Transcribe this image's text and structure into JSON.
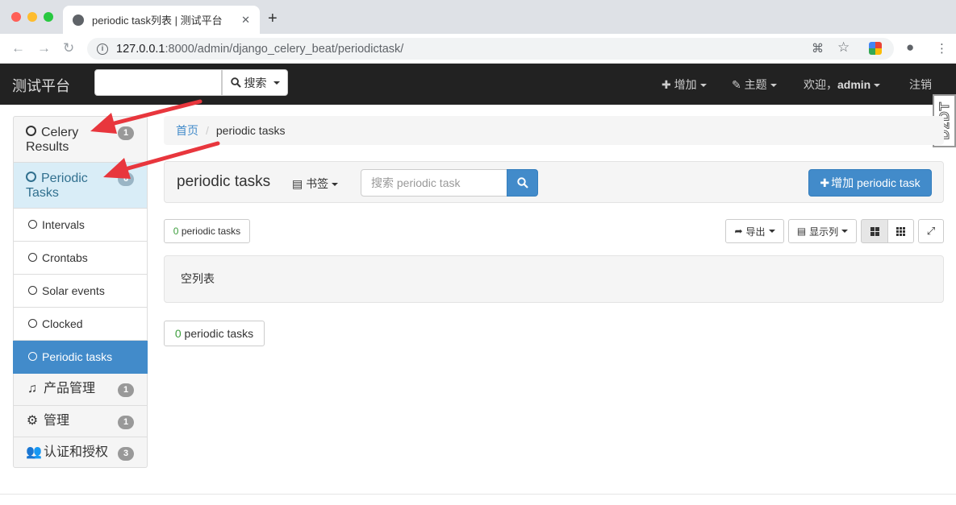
{
  "browser": {
    "tab_title": "periodic task列表 | 测试平台",
    "new_tab": "+",
    "url_host": "127.0.0.1",
    "url_path": ":8000/admin/django_celery_beat/periodictask/",
    "colors": {
      "close": "#ff5f57",
      "minimize": "#febc2e",
      "maximize": "#28c840"
    }
  },
  "navbar": {
    "brand": "测试平台",
    "search_placeholder": "",
    "search_label": "搜索",
    "add_label": "增加",
    "theme_label": "主题",
    "welcome_label": "欢迎，",
    "user": "admin",
    "logout_label": "注销"
  },
  "watermark": "DzDT",
  "sidebar": {
    "groups": [
      {
        "label": "Celery Results",
        "count": "1"
      },
      {
        "label": "Periodic Tasks",
        "count": "6"
      }
    ],
    "sub_items": [
      "Intervals",
      "Crontabs",
      "Solar events",
      "Clocked",
      "Periodic tasks"
    ],
    "apps": [
      {
        "label": "产品管理",
        "count": "1",
        "icon": "music-icon"
      },
      {
        "label": "管理",
        "count": "1",
        "icon": "gear-icon"
      },
      {
        "label": "认证和授权",
        "count": "3",
        "icon": "users-icon"
      }
    ]
  },
  "breadcrumb": {
    "home": "首页",
    "current": "periodic tasks"
  },
  "panel": {
    "title": "periodic tasks",
    "bookmark_label": "书签",
    "search_placeholder": "搜索 periodic task",
    "add_label": "增加 periodic task"
  },
  "toolbar": {
    "count_num": "0",
    "count_text": " periodic tasks",
    "export_label": "导出",
    "columns_label": "显示列"
  },
  "list": {
    "empty_text": "空列表"
  },
  "accent": "#428bca"
}
